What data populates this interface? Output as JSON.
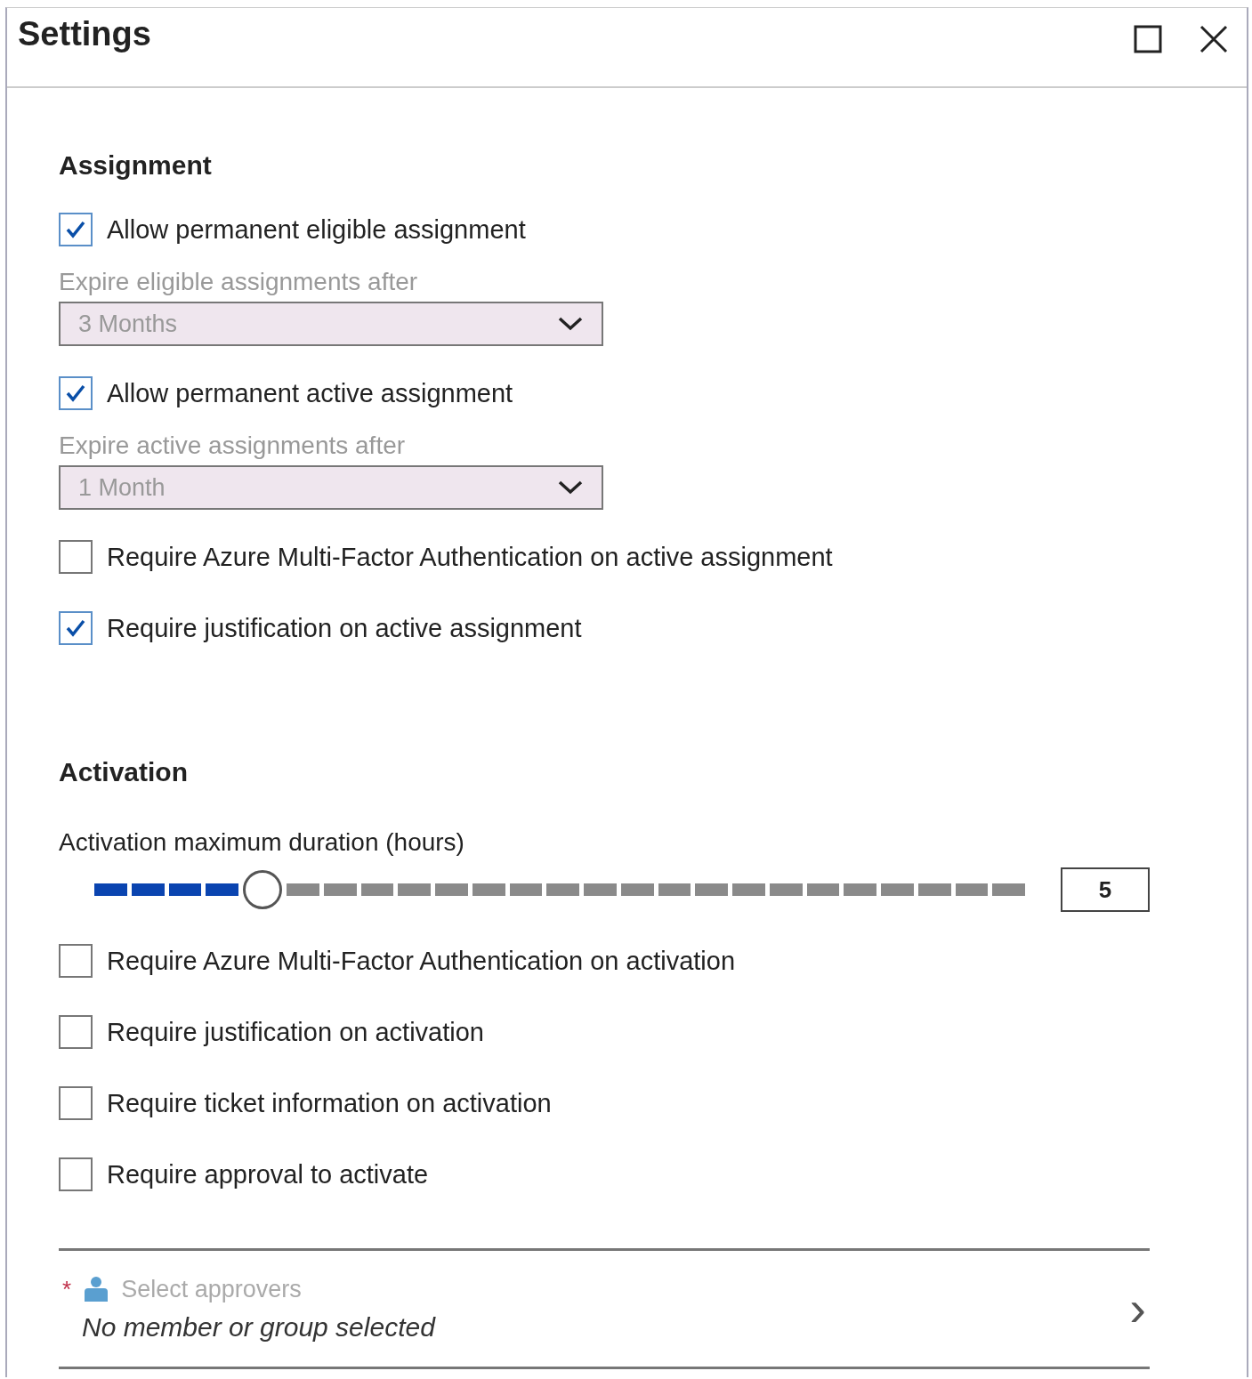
{
  "window": {
    "title": "Settings"
  },
  "sections": [
    {
      "heading": "Assignment",
      "items": [
        {
          "kind": "checkbox",
          "label": "Allow permanent eligible assignment",
          "checked": true
        },
        {
          "kind": "dropdown",
          "label": "Expire eligible assignments after",
          "value": "3 Months"
        },
        {
          "kind": "checkbox",
          "label": "Allow permanent active assignment",
          "checked": true
        },
        {
          "kind": "dropdown",
          "label": "Expire active assignments after",
          "value": "1 Month"
        },
        {
          "kind": "checkbox",
          "label": "Require Azure Multi-Factor Authentication on active assignment",
          "checked": false
        },
        {
          "kind": "checkbox",
          "label": "Require justification on active assignment",
          "checked": true
        }
      ]
    },
    {
      "heading": "Activation",
      "items": [
        {
          "kind": "slider",
          "label": "Activation maximum duration (hours)",
          "level": 0.17,
          "value": "5"
        },
        {
          "kind": "checkbox",
          "label": "Require Azure Multi-Factor Authentication on activation",
          "checked": false
        },
        {
          "kind": "checkbox",
          "label": "Require justification on activation",
          "checked": false
        },
        {
          "kind": "checkbox",
          "label": "Require ticket information on activation",
          "checked": false
        },
        {
          "kind": "checkbox",
          "label": "Require approval to activate",
          "checked": false
        }
      ]
    }
  ],
  "approvers": {
    "required_mark": "*",
    "placeholder": "Select approvers",
    "status": "No member or group selected",
    "chevron": "›"
  }
}
